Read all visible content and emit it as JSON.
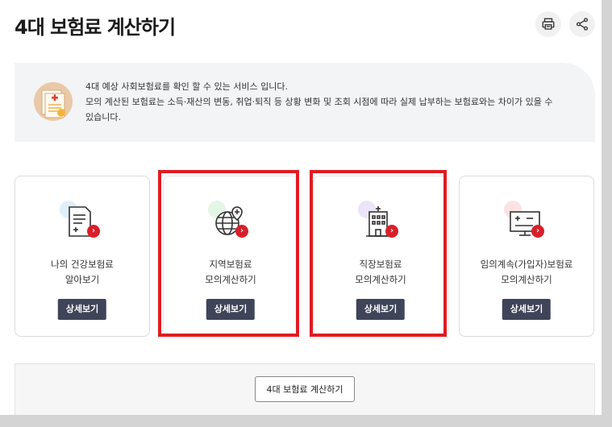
{
  "page": {
    "title": "4대 보험료 계산하기"
  },
  "toolbar": {
    "print_icon": "printer-icon",
    "share_icon": "share-icon"
  },
  "notice": {
    "line1": "4대 예상 사회보험료를 확인 할 수 있는 서비스 입니다.",
    "line2": "모의 계산된 보험료는 소득·재산의 변동, 취업·퇴직 등 상황 변화 및 조회 시점에 따라 실제 납부하는 보험료와는 차이가 있을 수",
    "line3": "있습니다."
  },
  "cards": [
    {
      "icon": "document-icon",
      "label_line1": "나의 건강보험료",
      "label_line2": "알아보기",
      "button": "상세보기",
      "bubble_color": "#dff0fb"
    },
    {
      "icon": "globe-location-icon",
      "label_line1": "지역보험료",
      "label_line2": "모의계산하기",
      "button": "상세보기",
      "bubble_color": "#e4f6e6"
    },
    {
      "icon": "office-building-icon",
      "label_line1": "직장보험료",
      "label_line2": "모의계산하기",
      "button": "상세보기",
      "bubble_color": "#ece4f8"
    },
    {
      "icon": "monitor-calculator-icon",
      "label_line1": "임의계속(가입자)보험료",
      "label_line2": "모의계산하기",
      "button": "상세보기",
      "bubble_color": "#fbe3e3"
    }
  ],
  "footer": {
    "calc_button": "4대 보험료 계산하기"
  },
  "colors": {
    "button_dark": "#3f4458",
    "highlight_red": "#e11b22",
    "badge_red": "#d81f2a",
    "notice_bg": "#f3f4f6"
  }
}
